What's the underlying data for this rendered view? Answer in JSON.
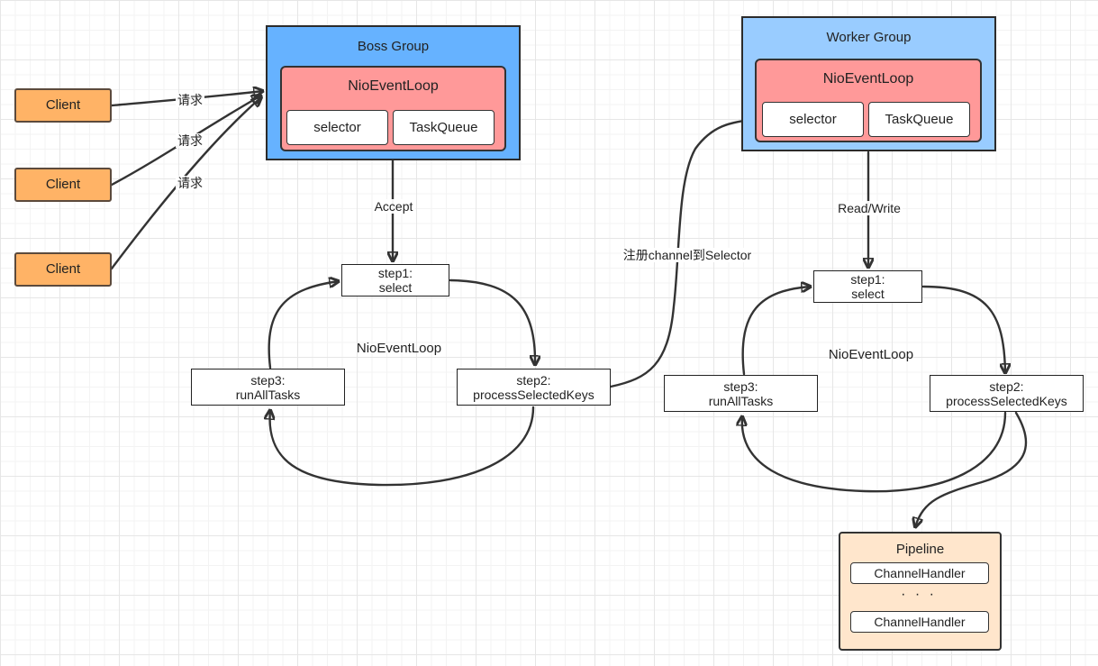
{
  "clients": [
    {
      "label": "Client"
    },
    {
      "label": "Client"
    },
    {
      "label": "Client"
    }
  ],
  "request_label": "请求",
  "boss_group": {
    "title": "Boss Group",
    "loop_title": "NioEventLoop",
    "selector": "selector",
    "task_queue": "TaskQueue",
    "edge_label": "Accept",
    "loop_center_label": "NioEventLoop",
    "steps": {
      "select": "step1:\nselect",
      "process": "step2:\nprocessSelectedKeys",
      "run": "step3:\nrunAllTasks"
    }
  },
  "register_label": "注册channel到Selector",
  "worker_group": {
    "title": "Worker Group",
    "loop_title": "NioEventLoop",
    "selector": "selector",
    "task_queue": "TaskQueue",
    "edge_label": "Read/Write",
    "loop_center_label": "NioEventLoop",
    "steps": {
      "select": "step1:\nselect",
      "process": "step2:\nprocessSelectedKeys",
      "run": "step3:\nrunAllTasks"
    }
  },
  "pipeline": {
    "title": "Pipeline",
    "handlers": [
      "ChannelHandler",
      "ChannelHandler"
    ],
    "ellipsis": "· · ·"
  }
}
